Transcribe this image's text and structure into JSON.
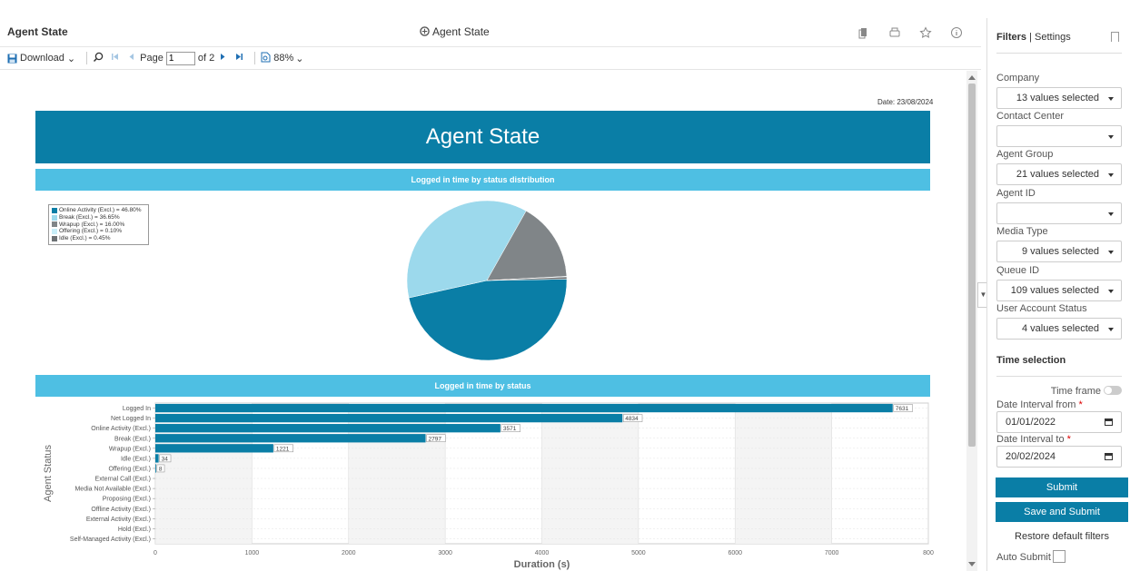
{
  "header": {
    "title": "Agent State",
    "center_title": "Agent State"
  },
  "toolbar": {
    "download_label": "Download",
    "page_label": "Page",
    "page_value": "1",
    "page_of": "of 2",
    "zoom": "88%"
  },
  "report": {
    "date": "Date: 23/08/2024",
    "banner_title": "Agent State",
    "section1_title": "Logged in time by status distribution",
    "section2_title": "Logged in time by status"
  },
  "chart_data": [
    {
      "type": "pie",
      "legend": [
        "Online Activity (Excl.) = 46.80%",
        "Break (Excl.) = 36.65%",
        "Wrapup (Excl.) = 16.00%",
        "Offering (Excl.) = 0.10%",
        "Idle (Excl.) = 0.45%"
      ],
      "slices": [
        {
          "name": "Online Activity (Excl.)",
          "value": 46.8,
          "color": "#0a7ea6"
        },
        {
          "name": "Break (Excl.)",
          "value": 36.65,
          "color": "#9cd9ec"
        },
        {
          "name": "Wrapup (Excl.)",
          "value": 16.0,
          "color": "#808588"
        },
        {
          "name": "Offering (Excl.)",
          "value": 0.1,
          "color": "#c8eef8"
        },
        {
          "name": "Idle (Excl.)",
          "value": 0.45,
          "color": "#6d7275"
        }
      ]
    },
    {
      "type": "bar",
      "orientation": "horizontal",
      "ylabel": "Agent Status",
      "xlabel": "Duration (s)",
      "xlim": [
        0,
        8000
      ],
      "xticks": [
        "0",
        "1000",
        "2000",
        "3000",
        "4000",
        "5000",
        "6000",
        "7000",
        "800"
      ],
      "categories": [
        "Logged In",
        "Net Logged In",
        "Online Activity (Excl.)",
        "Break (Excl.)",
        "Wrapup (Excl.)",
        "Idle (Excl.)",
        "Offering (Excl.)",
        "External Call (Excl.)",
        "Media Not Available (Excl.)",
        "Proposing (Excl.)",
        "Offline Activity (Excl.)",
        "External Activity (Excl.)",
        "Hold (Excl.)",
        "Self-Managed Activity (Excl.)"
      ],
      "values": [
        7631,
        4834,
        3571,
        2797,
        1221,
        34,
        8,
        0,
        0,
        0,
        0,
        0,
        0,
        0
      ],
      "labels": [
        "7631",
        "4834",
        "3571",
        "2797",
        "1221",
        "34",
        "8",
        "",
        "",
        "",
        "",
        "",
        "",
        ""
      ],
      "bar_color": "#0a7ea6"
    }
  ],
  "panel": {
    "tab_filters": "Filters",
    "tab_sep": "|",
    "tab_settings": "Settings",
    "filters": [
      {
        "label": "Company",
        "value": "13 values selected"
      },
      {
        "label": "Contact Center",
        "value": ""
      },
      {
        "label": "Agent Group",
        "value": "21 values selected"
      },
      {
        "label": "Agent ID",
        "value": ""
      },
      {
        "label": "Media Type",
        "value": "9 values selected"
      },
      {
        "label": "Queue ID",
        "value": "109 values selected"
      },
      {
        "label": "User Account Status",
        "value": "4 values selected"
      }
    ],
    "time_section": "Time selection",
    "time_frame": "Time frame",
    "date_from_label": "Date Interval from",
    "date_from": "01/01/2022",
    "date_to_label": "Date Interval to",
    "date_to": "20/02/2024",
    "required_mark": "*",
    "submit": "Submit",
    "save_submit": "Save and Submit",
    "restore": "Restore default filters",
    "auto_submit": "Auto Submit"
  }
}
